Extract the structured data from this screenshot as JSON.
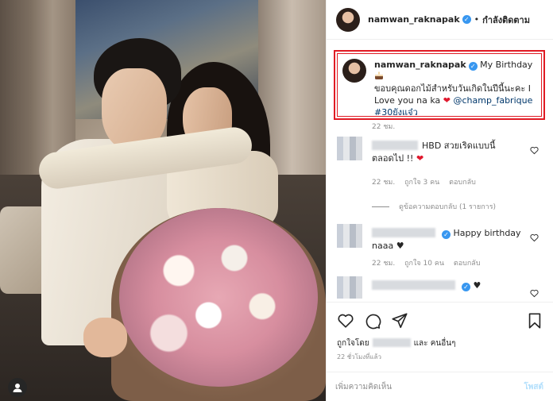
{
  "header": {
    "username": "namwan_raknapak",
    "separator": "•",
    "follow_status": "กำลังติดตาม"
  },
  "caption": {
    "username": "namwan_raknapak",
    "line1": "My Birthday",
    "line2": "ขอบคุณดอกไม้สำหรับวันเกิดในปีนี้นะคะ I",
    "line3": "Love you na ka",
    "mention": "@champ_fabrique",
    "hashtag": "#30ยังแจ๋ว",
    "time": "22 ชม."
  },
  "comments": [
    {
      "text": "HBD สวยเริดแบบนี้",
      "text2": "ตลอดไป !!",
      "time": "22 ชม.",
      "likes": "ถูกใจ 3 คน",
      "reply": "ตอบกลับ"
    },
    {
      "text": "Happy birthday",
      "text2": "naaa ♥",
      "time": "22 ชม.",
      "likes": "ถูกใจ 10 คน",
      "reply": "ตอบกลับ"
    },
    {
      "text": "♥",
      "text2": "",
      "time": "",
      "likes": "",
      "reply": ""
    }
  ],
  "view_replies": "ดูข้อความตอบกลับ (1 รายการ)",
  "likes": {
    "prefix": "ถูกใจโดย",
    "suffix": "และ คนอื่นๆ"
  },
  "post_time": "22 ชั่วโมงที่แล้ว",
  "add_comment": {
    "placeholder": "เพิ่มความคิดเห็น",
    "post_label": "โพสต์"
  },
  "icons": {
    "heart": "heart-icon",
    "comment": "comment-icon",
    "share": "share-icon",
    "bookmark": "bookmark-icon",
    "cake": "cake-icon",
    "account": "account-icon"
  },
  "colors": {
    "highlight_border": "#e01b24",
    "verified": "#3897f0",
    "link": "#00376b",
    "muted": "#8e8e8e"
  }
}
